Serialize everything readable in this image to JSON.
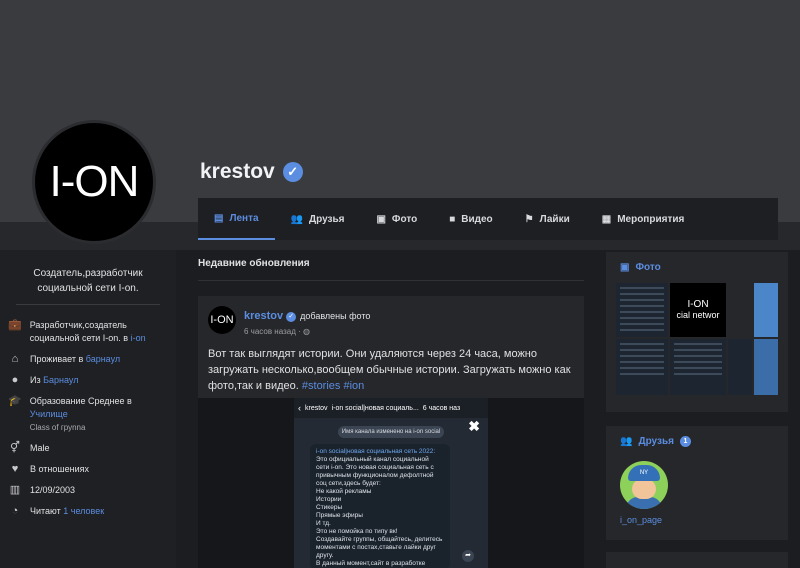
{
  "profile": {
    "avatar_text": "I-ON",
    "name": "krestov"
  },
  "tabs": [
    {
      "label": "Лента",
      "icon": "feed-icon",
      "active": true
    },
    {
      "label": "Друзья",
      "icon": "users-icon"
    },
    {
      "label": "Фото",
      "icon": "photos-icon"
    },
    {
      "label": "Видео",
      "icon": "video-icon"
    },
    {
      "label": "Лайки",
      "icon": "flag-icon"
    },
    {
      "label": "Мероприятия",
      "icon": "calendar-icon"
    }
  ],
  "about": {
    "bio": "Создатель,разработчик социальной сети I-on.",
    "work_text": "Разработчик,создатель социальной сети I-on. в",
    "work_link": "i-on",
    "lives_label": "Проживает в",
    "lives_link": "барнаул",
    "from_label": "Из",
    "from_link": "Барнаул",
    "education_label": "Образование Среднее в",
    "education_link": "Училище",
    "education_class": "Class of груnna",
    "gender": "Male",
    "relationship": "В отношениях",
    "birthday": "12/09/2003",
    "followers_label": "Читают",
    "followers_link": "1 человек"
  },
  "feed": {
    "title": "Недавние обновления"
  },
  "post": {
    "avatar_text": "I-ON",
    "author": "krestov",
    "action": "добавлены фото",
    "time": "6 часов назад ·",
    "text": "Вот так выглядят истории. Они удаляются через 24 часа, можно загружать несколько,вообщем обычные истории. Загружать можно как фото,так и видео.",
    "tags": "#stories #ion",
    "media": {
      "channel": "i-on social|новая социаль...",
      "author_short": "krestov",
      "time": "6 часов наз",
      "system_msg": "Имя канала изменено на i-on social",
      "bubble_title": "i-on social|новая социальная сеть 2022:",
      "bubble_lines": [
        "Это официальный канал социальной",
        "сети i-on. Это новая социальная сеть с",
        "привычным функционалом дефолтной",
        "соц сети,здесь будет:",
        "Не какой рекламы",
        "Истории",
        "Стикеры",
        "Прямые эфиры",
        "И тд.",
        "Это не помойка по типу вк!",
        "Создавайте группы, общайтесь, делитесь",
        "моментами с постах,ставьте лайки друг",
        "другу.",
        "В данный момент,сайт в разработке"
      ]
    }
  },
  "photos_card": {
    "title": "Фото",
    "thumb_text": "I-ON",
    "thumb_sub": "cial networ"
  },
  "friends_card": {
    "title": "Друзья",
    "count": "1",
    "friend_name": "i_on_page",
    "friend_cap": "NY"
  },
  "colors": {
    "accent": "#5b8de0",
    "bg": "#1c1d20",
    "card": "#26272a",
    "cover": "#3a3b3e"
  }
}
